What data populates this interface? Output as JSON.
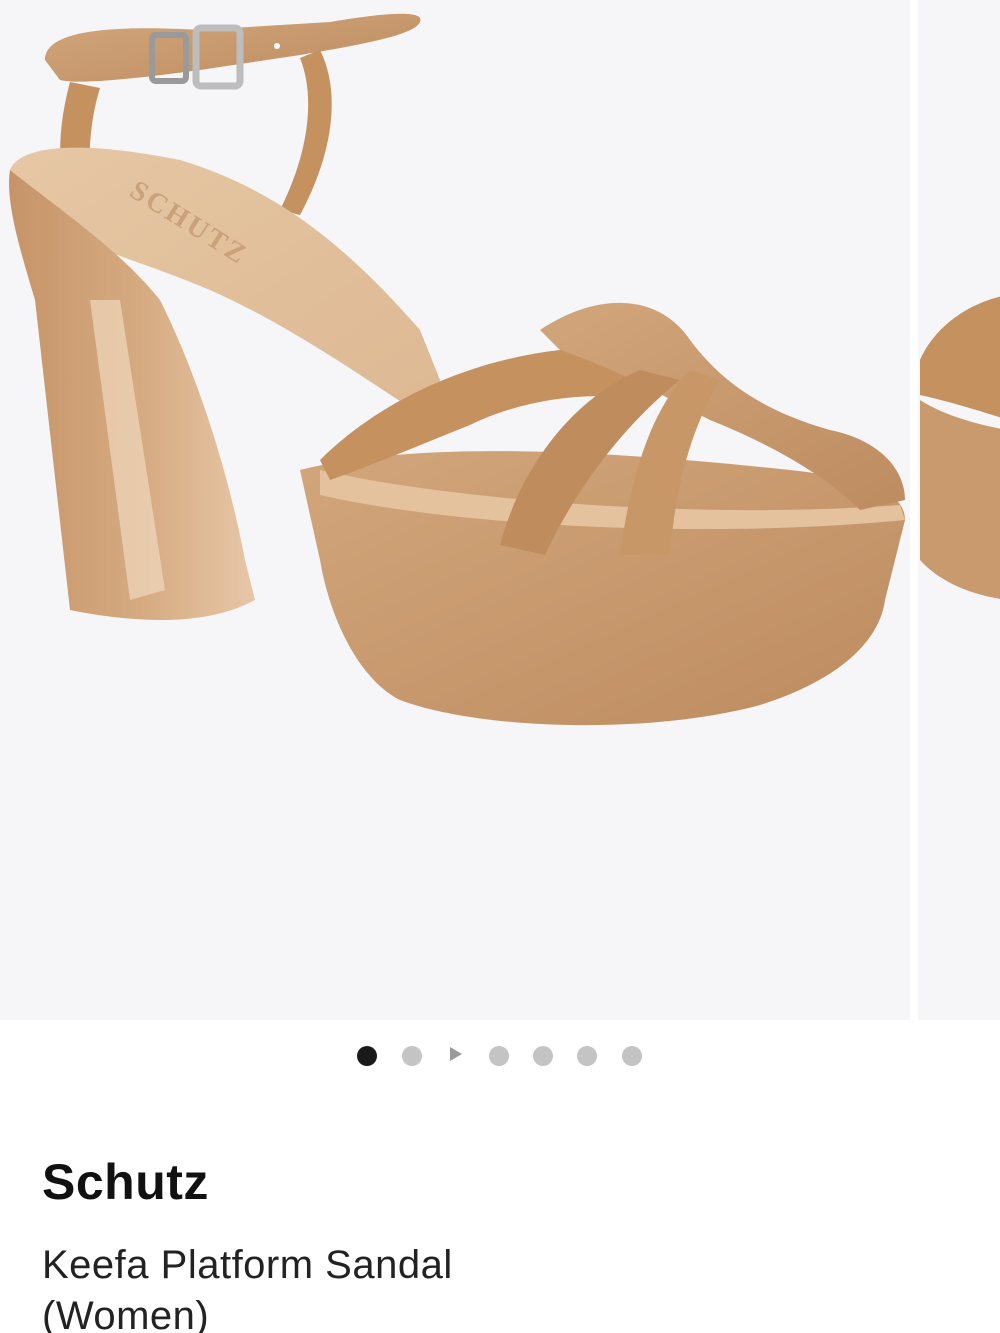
{
  "product": {
    "brand": "Schutz",
    "name_line1": "Keefa Platform Sandal",
    "name_line2": "(Women)",
    "insole_logo": "SCHUTZ"
  },
  "gallery": {
    "image_count": 6,
    "active_index": 0,
    "indicators": [
      "dot",
      "dot",
      "play",
      "dot",
      "dot",
      "dot",
      "dot"
    ]
  },
  "colors": {
    "background": "#ffffff",
    "image_background": "#f6f5f7",
    "suede": "#c99a6e",
    "active_dot": "#1a1a1a",
    "inactive_dot": "#c4c4c4"
  }
}
